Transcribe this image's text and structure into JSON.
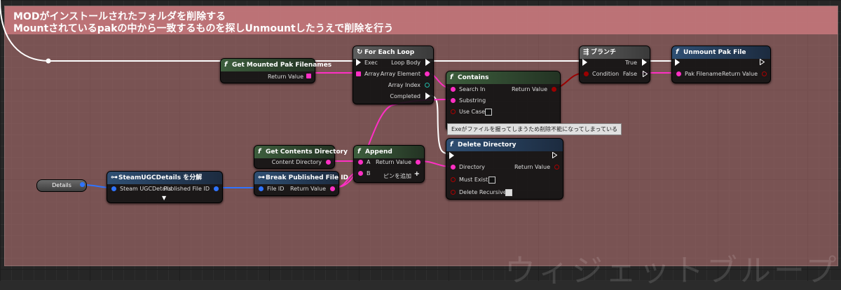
{
  "comment": {
    "line1": "MODがインストールされたフォルダを削除する",
    "line2": "Mountされているpakの中から一致するものを探しUnmountしたうえで削除を行う"
  },
  "watermark": "ウィジェットブループリ",
  "nodes": {
    "get_mounted": {
      "title": "Get Mounted Pak Filenames",
      "return_value": "Return Value"
    },
    "foreach": {
      "title": "For Each Loop",
      "exec": "Exec",
      "array": "Array",
      "loop_body": "Loop Body",
      "array_element": "Array Element",
      "array_index": "Array Index",
      "completed": "Completed"
    },
    "contains": {
      "title": "Contains",
      "search_in": "Search In",
      "substring": "Substring",
      "use_case": "Use Case",
      "return_value": "Return Value"
    },
    "branch": {
      "title": "ブランチ",
      "condition": "Condition",
      "true": "True",
      "false": "False"
    },
    "unmount": {
      "title": "Unmount Pak File",
      "pak_filename": "Pak Filename",
      "return_value": "Return Value"
    },
    "steam_break": {
      "title": "SteamUGCDetails を分解",
      "steam_ugc_details": "Steam UGCDetails",
      "published_file_id": "Published File ID"
    },
    "details": {
      "label": "Details"
    },
    "get_contents": {
      "title": "Get Contents Directory",
      "content_directory": "Content Directory"
    },
    "break_pfid": {
      "title": "Break Published File ID",
      "file_id": "File ID",
      "return_value": "Return Value"
    },
    "append": {
      "title": "Append",
      "a": "A",
      "b": "B",
      "return_value": "Return Value",
      "add_pin": "ピンを追加"
    },
    "delete_dir": {
      "title": "Delete Directory",
      "directory": "Directory",
      "return_value": "Return Value",
      "must_exist": "Must Exist",
      "delete_recursively": "Delete Recursively"
    }
  },
  "tooltip": "Exeがファイルを握ってしまうため削除不能になってしまっている",
  "colors": {
    "exec": "#ffffff",
    "string_pin": "#ff2fc4",
    "struct_pin": "#2f74ff",
    "bool_pin": "#9b0000"
  }
}
